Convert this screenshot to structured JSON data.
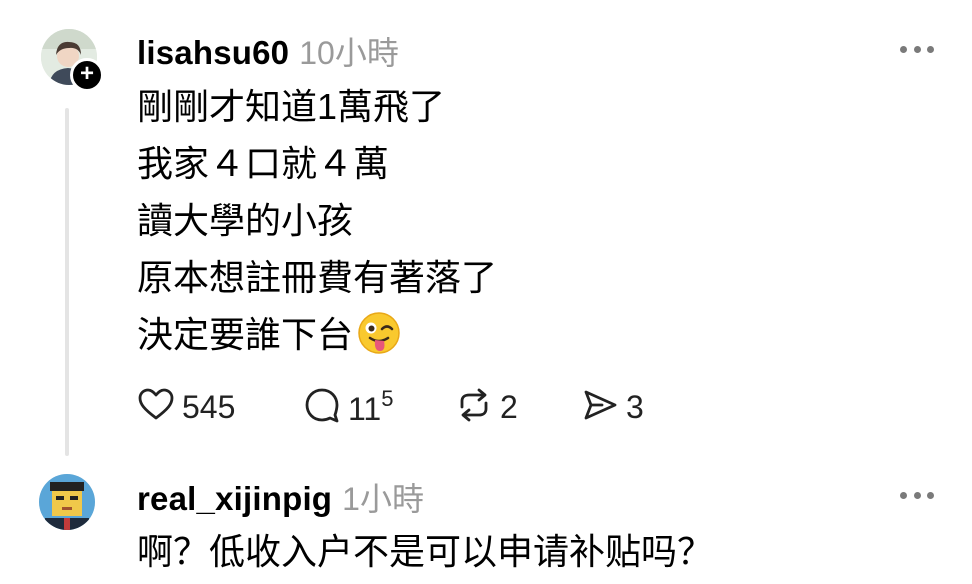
{
  "posts": [
    {
      "username": "lisahsu60",
      "time": "10小時",
      "lines": [
        "剛剛才知道1萬飛了",
        "我家４口就４萬",
        "讀大學的小孩",
        "原本想註冊費有著落了",
        "決定要誰下台"
      ],
      "emoji": "winking-face-with-tongue",
      "follow_badge": "+",
      "actions": {
        "likes": "545",
        "replies": "11",
        "replies_sup": "5",
        "reposts": "2",
        "shares": "3"
      }
    },
    {
      "username": "real_xijinpig",
      "time": "1小時",
      "lines": [
        "啊？低收入户不是可以申请补贴吗？"
      ]
    }
  ],
  "icons": [
    "more-icon",
    "heart-icon",
    "comment-icon",
    "repost-icon",
    "share-icon",
    "plus-icon"
  ],
  "colors": {
    "text": "#000000",
    "secondary": "#9a9a9a",
    "thread_line": "#e4e4e4",
    "badge": "#000000"
  }
}
